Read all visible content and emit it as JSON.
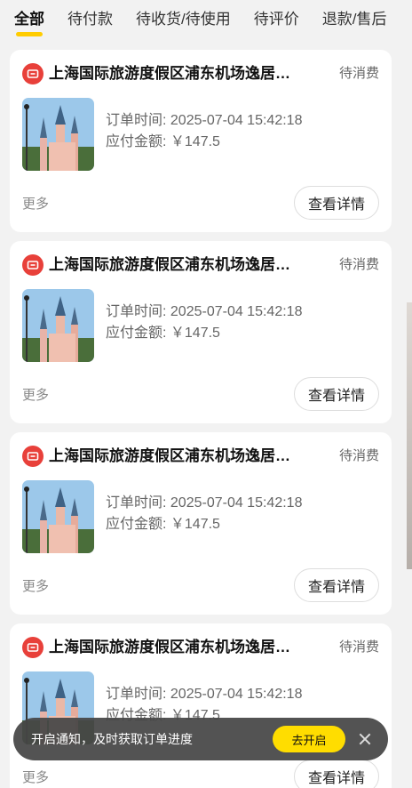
{
  "tabs": [
    {
      "label": "全部",
      "active": true
    },
    {
      "label": "待付款"
    },
    {
      "label": "待收货/待使用"
    },
    {
      "label": "待评价"
    },
    {
      "label": "退款/售后"
    }
  ],
  "orders": [
    {
      "shop_name": "上海国际旅游度假区浦东机场逸居…",
      "status": "待消费",
      "order_time_label": "订单时间: 2025-07-04 15:42:18",
      "amount_label": "应付金额: ￥147.5",
      "more": "更多",
      "detail_button": "查看详情"
    },
    {
      "shop_name": "上海国际旅游度假区浦东机场逸居…",
      "status": "待消费",
      "order_time_label": "订单时间: 2025-07-04 15:42:18",
      "amount_label": "应付金额: ￥147.5",
      "more": "更多",
      "detail_button": "查看详情"
    },
    {
      "shop_name": "上海国际旅游度假区浦东机场逸居…",
      "status": "待消费",
      "order_time_label": "订单时间: 2025-07-04 15:42:18",
      "amount_label": "应付金额: ￥147.5",
      "more": "更多",
      "detail_button": "查看详情"
    },
    {
      "shop_name": "上海国际旅游度假区浦东机场逸居…",
      "status": "待消费",
      "order_time_label": "订单时间: 2025-07-04 15:42:18",
      "amount_label": "应付金额: ￥147.5",
      "more": "更多",
      "detail_button": "查看详情"
    }
  ],
  "notification_toast": {
    "text": "开启通知，及时获取订单进度",
    "button": "去开启",
    "close_icon": "close-icon"
  },
  "colors": {
    "accent_yellow": "#ffcc00",
    "shop_icon_red": "#e8403a",
    "toast_bg": "#464646"
  }
}
